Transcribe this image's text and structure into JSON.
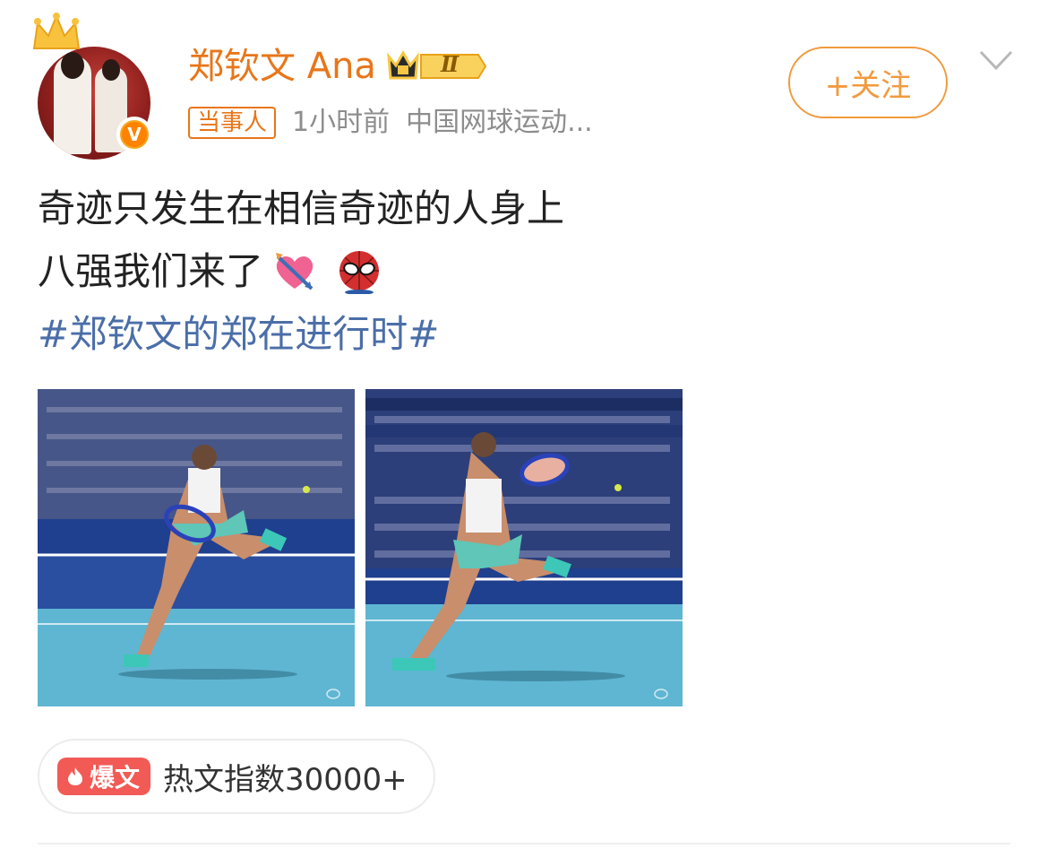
{
  "post": {
    "author": {
      "name": "郑钦文 Ana",
      "level": "Ⅱ",
      "verified_mark": "V"
    },
    "meta": {
      "tag": "当事人",
      "time": "1小时前",
      "source": "中国网球运动..."
    },
    "follow_label": "+关注",
    "text_lines": [
      "奇迹只发生在相信奇迹的人身上",
      "八强我们来了"
    ],
    "emojis": [
      "heart-with-arrow-icon",
      "spider-man-icon"
    ],
    "hashtag": "#郑钦文的郑在进行时#",
    "images": [
      "tennis-photo-1",
      "tennis-photo-2"
    ],
    "hot": {
      "badge_label": "爆文",
      "text": "热文指数30000+"
    }
  },
  "colors": {
    "accent_orange": "#e8761a",
    "hashtag_blue": "#4b6ea8",
    "hot_red": "#f25a56"
  }
}
